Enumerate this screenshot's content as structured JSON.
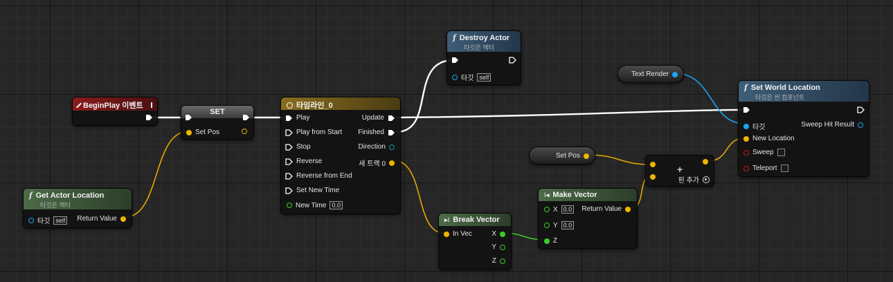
{
  "nodes": {
    "beginplay": {
      "title": "BeginPlay 이벤트"
    },
    "set": {
      "title": "SET",
      "pin_setpos": "Set Pos"
    },
    "timeline": {
      "title": "타임라인_0",
      "inputs": [
        "Play",
        "Play from Start",
        "Stop",
        "Reverse",
        "Reverse from End",
        "Set New Time"
      ],
      "new_time_label": "New Time",
      "new_time_value": "0.0",
      "outputs": [
        "Update",
        "Finished",
        "Direction",
        "새 트랙 0"
      ]
    },
    "destroy": {
      "title": "Destroy Actor",
      "subtitle": "타깃은 액터",
      "target_label": "타깃",
      "target_value": "self"
    },
    "getloc": {
      "title": "Get Actor Location",
      "subtitle": "타깃은 액터",
      "target_label": "타깃",
      "target_value": "self",
      "return_label": "Return Value"
    },
    "breakvec": {
      "title": "Break Vector",
      "in_label": "In Vec",
      "x": "X",
      "y": "Y",
      "z": "Z"
    },
    "makevec": {
      "title": "Make Vector",
      "x": "X",
      "x_value": "0.0",
      "y": "Y",
      "y_value": "0.0",
      "z": "Z",
      "return_label": "Return Value"
    },
    "setpos_var": {
      "title": "Set Pos"
    },
    "add": {
      "add_pin_label": "핀 추가",
      "plus": "+"
    },
    "textrender": {
      "title": "Text Render"
    },
    "setworld": {
      "title": "Set World Location",
      "subtitle": "타깃은 씬 컴포넌트",
      "target_label": "타깃",
      "new_location_label": "New Location",
      "sweep_label": "Sweep",
      "teleport_label": "Teleport",
      "sweep_hit_label": "Sweep Hit Result"
    }
  },
  "colors": {
    "exec": "#ffffff",
    "vector": "#f0b400",
    "object": "#1aa6f0",
    "float": "#3ccc2a",
    "bool": "#d21616",
    "event_header": "#8a1c1c",
    "function_header": "#3f5e78",
    "pure_header": "#4c6b47",
    "timeline_header": "#8a6d1e"
  },
  "icons": {
    "function": "f-icon",
    "event": "event-diamond-icon",
    "timeline": "clock-icon",
    "break": "break-struct-icon",
    "make": "make-struct-icon"
  }
}
